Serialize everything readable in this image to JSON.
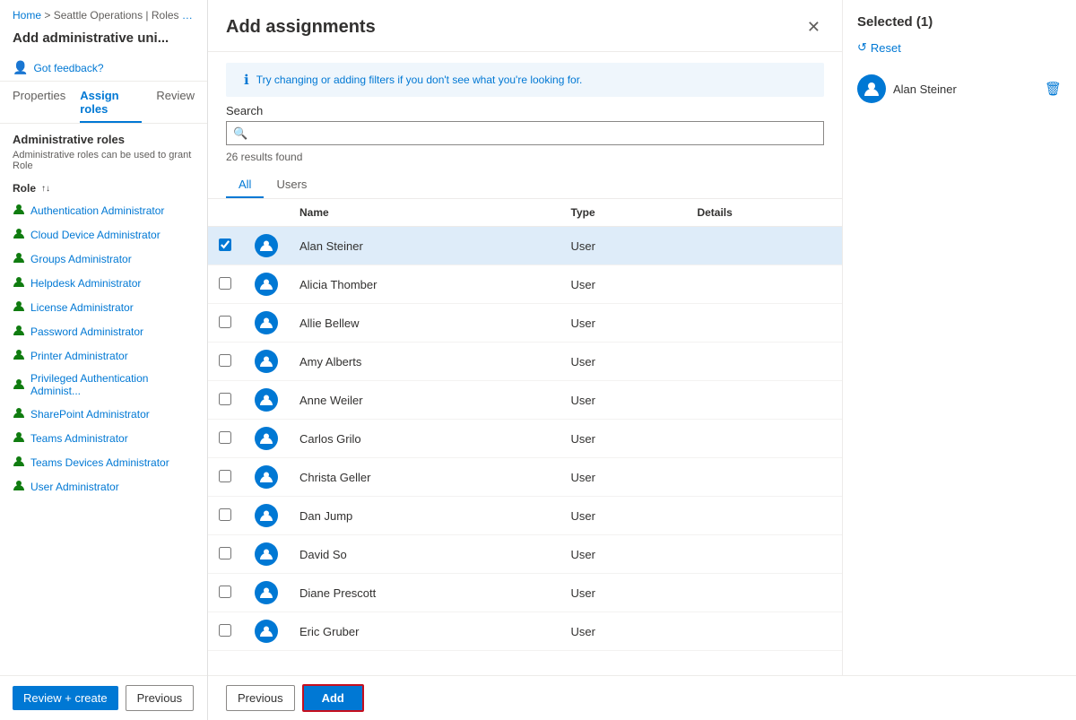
{
  "breadcrumb": {
    "home": "Home",
    "separator": ">",
    "current": "Seattle Operations | Roles and..."
  },
  "page_title": "Add administrative uni...",
  "feedback": "Got feedback?",
  "tabs": [
    {
      "label": "Properties",
      "active": false
    },
    {
      "label": "Assign roles",
      "active": true
    },
    {
      "label": "Review",
      "active": false
    }
  ],
  "admin_roles": {
    "title": "Administrative roles",
    "description": "Administrative roles can be used to grant Role",
    "role_header": "Role",
    "roles": [
      {
        "label": "Authentication Administrator"
      },
      {
        "label": "Cloud Device Administrator"
      },
      {
        "label": "Groups Administrator"
      },
      {
        "label": "Helpdesk Administrator"
      },
      {
        "label": "License Administrator"
      },
      {
        "label": "Password Administrator"
      },
      {
        "label": "Printer Administrator"
      },
      {
        "label": "Privileged Authentication Administ..."
      },
      {
        "label": "SharePoint Administrator"
      },
      {
        "label": "Teams Administrator"
      },
      {
        "label": "Teams Devices Administrator"
      },
      {
        "label": "User Administrator"
      }
    ]
  },
  "bottom_bar": {
    "review_create": "Review + create",
    "previous": "Previous"
  },
  "modal": {
    "title": "Add assignments",
    "close_label": "✕",
    "info_text": "Try changing or adding filters if you don't see what you're looking for.",
    "search": {
      "label": "Search",
      "placeholder": ""
    },
    "results_count": "26 results found",
    "filter_tabs": [
      {
        "label": "All",
        "active": true
      },
      {
        "label": "Users",
        "active": false
      }
    ],
    "table": {
      "columns": [
        {
          "label": "",
          "key": "checkbox"
        },
        {
          "label": "",
          "key": "icon"
        },
        {
          "label": "Name",
          "key": "name"
        },
        {
          "label": "Type",
          "key": "type"
        },
        {
          "label": "Details",
          "key": "details"
        }
      ],
      "rows": [
        {
          "name": "Alan Steiner",
          "type": "User",
          "details": "",
          "selected": true
        },
        {
          "name": "Alicia Thomber",
          "type": "User",
          "details": "",
          "selected": false
        },
        {
          "name": "Allie Bellew",
          "type": "User",
          "details": "",
          "selected": false
        },
        {
          "name": "Amy Alberts",
          "type": "User",
          "details": "",
          "selected": false
        },
        {
          "name": "Anne Weiler",
          "type": "User",
          "details": "",
          "selected": false
        },
        {
          "name": "Carlos Grilo",
          "type": "User",
          "details": "",
          "selected": false
        },
        {
          "name": "Christa Geller",
          "type": "User",
          "details": "",
          "selected": false
        },
        {
          "name": "Dan Jump",
          "type": "User",
          "details": "",
          "selected": false
        },
        {
          "name": "David So",
          "type": "User",
          "details": "",
          "selected": false
        },
        {
          "name": "Diane Prescott",
          "type": "User",
          "details": "",
          "selected": false
        },
        {
          "name": "Eric Gruber",
          "type": "User",
          "details": "",
          "selected": false
        }
      ]
    },
    "selected_panel": {
      "title": "Selected (1)",
      "reset_label": "Reset",
      "users": [
        {
          "name": "Alan Steiner"
        }
      ]
    },
    "bottom": {
      "previous": "Previous",
      "add": "Add"
    }
  }
}
